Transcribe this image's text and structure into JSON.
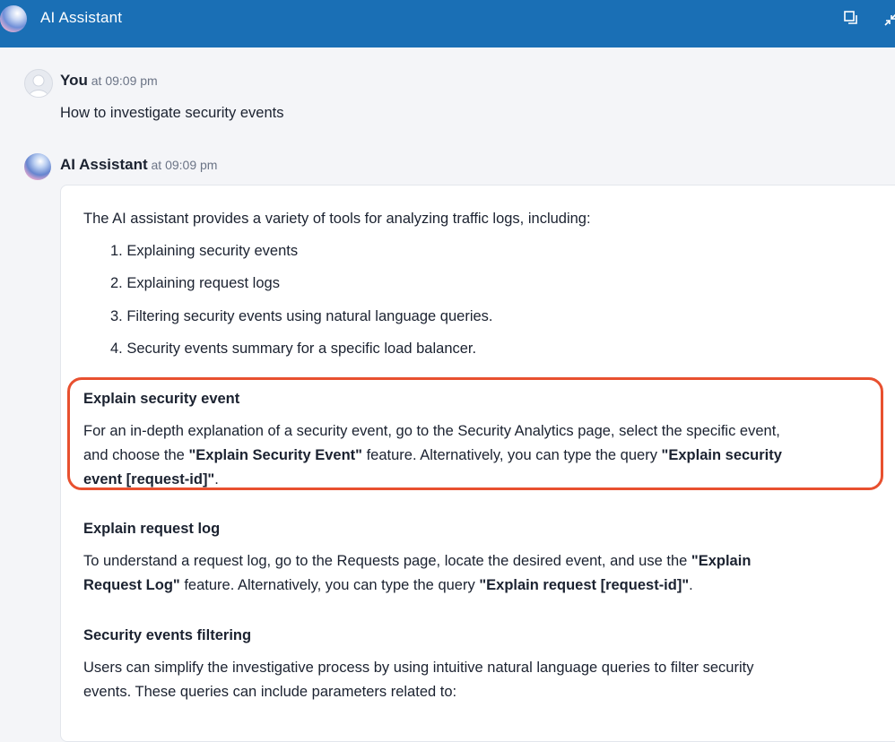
{
  "header": {
    "title": "AI Assistant",
    "accent": "#1a6fb5"
  },
  "messages": {
    "user": {
      "name": "You",
      "time": "at 09:09 pm",
      "text": "How to investigate security events"
    },
    "assistant": {
      "name": "AI Assistant",
      "time": "at 09:09 pm",
      "intro": "The AI assistant provides a variety of tools for analyzing traffic logs, including:",
      "list": [
        "1. Explaining security events",
        "2. Explaining request logs",
        "3. Filtering security events using natural language queries.",
        "4. Security events summary for a specific load balancer."
      ],
      "sections": [
        {
          "title": "Explain security event",
          "p1": "For an in-depth explanation of a security event, go to the Security Analytics page, select the specific event,",
          "p2a": "and choose the ",
          "p2b": "\"Explain Security Event\"",
          "p2c": " feature. Alternatively, you can type the query ",
          "p2d": "\"Explain security",
          "p3a": "event [request-id]\"",
          "p3b": "."
        },
        {
          "title": "Explain request log",
          "p1a": "To understand a request log, go to the Requests page, locate the desired event, and use the ",
          "p1b": "\"Explain",
          "p2a": "Request Log\"",
          "p2b": " feature. Alternatively, you can type the query ",
          "p2c": "\"Explain request [request-id]\"",
          "p2d": "."
        },
        {
          "title": "Security events filtering",
          "p1": "Users can simplify the investigative process by using intuitive natural language queries to filter security",
          "p2": "events. These queries can include parameters related to:"
        }
      ]
    }
  },
  "highlight_color": "#e8502f"
}
